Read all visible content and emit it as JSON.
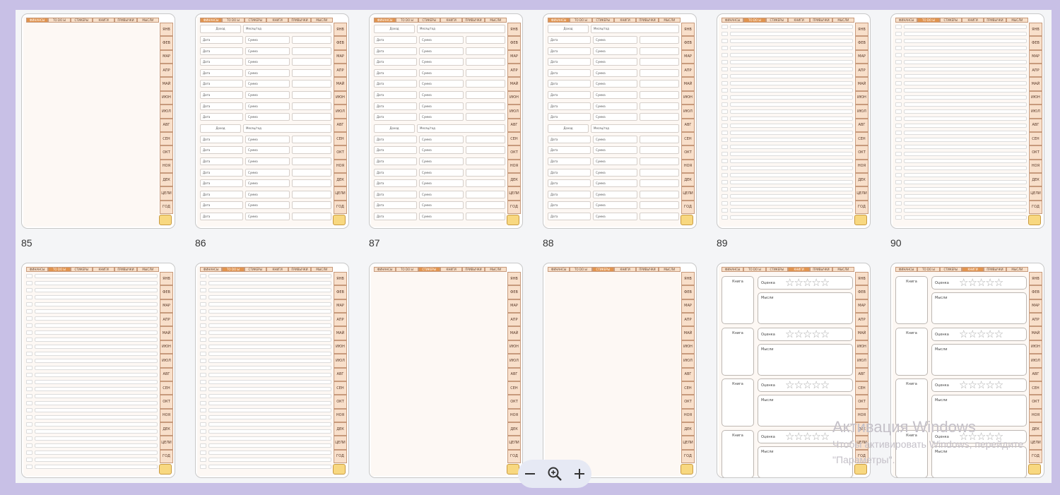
{
  "tab_labels": [
    "ФИНАНСЫ",
    "ТО DO Ы",
    "СТИКЕРЫ",
    "КНИГИ",
    "ПРИВЫЧКИ",
    "МЫСЛИ"
  ],
  "month_labels": [
    "ЯНВ",
    "ФЕВ",
    "МАР",
    "АПР",
    "МАЙ",
    "ИЮН",
    "ИЮЛ",
    "АВГ",
    "СЕН",
    "ОКТ",
    "НОЯ",
    "ДЕК",
    "ЦЕЛИ",
    "ГОД"
  ],
  "finance_labels": {
    "income": "Доход",
    "month_year": "Месяц/год",
    "date": "Дата",
    "sum": "Сумма"
  },
  "book_labels": {
    "book": "Книга",
    "rating": "Оценка",
    "thoughts": "Мысли",
    "stars": "☆☆☆☆☆"
  },
  "pages": [
    {
      "number": "85",
      "kind": "blank",
      "active_tab": 0
    },
    {
      "number": "86",
      "kind": "finance",
      "active_tab": 0
    },
    {
      "number": "87",
      "kind": "finance",
      "active_tab": 0
    },
    {
      "number": "88",
      "kind": "finance",
      "active_tab": 0
    },
    {
      "number": "89",
      "kind": "todo",
      "active_tab": 1
    },
    {
      "number": "90",
      "kind": "todo",
      "active_tab": 1
    },
    {
      "number": "",
      "kind": "todo",
      "active_tab": 1
    },
    {
      "number": "",
      "kind": "todo",
      "active_tab": 1
    },
    {
      "number": "",
      "kind": "blank",
      "active_tab": 2
    },
    {
      "number": "",
      "kind": "blank",
      "active_tab": 2
    },
    {
      "number": "",
      "kind": "books",
      "active_tab": 3
    },
    {
      "number": "",
      "kind": "books",
      "active_tab": 3
    }
  ],
  "zoom_controls": {
    "zoom_out_icon": "minus-icon",
    "zoom_icon": "magnifier-plus-icon",
    "zoom_in_icon": "plus-icon"
  },
  "watermark": {
    "title": "Активация Windows",
    "subtitle": "Чтобы активировать Windows, перейдите\n\"Параметры\"."
  },
  "colors": {
    "background": "#c8c0e6",
    "tab": "#f7dfc9",
    "tab_active": "#e1944f",
    "page": "#fdf8f4"
  }
}
